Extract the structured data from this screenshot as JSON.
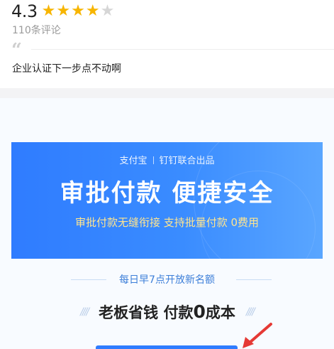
{
  "rating": {
    "score": "4.3",
    "stars_full": 4,
    "stars_total": 5,
    "review_count": "110条评论"
  },
  "review": {
    "text": "企业认证下一步点不动啊"
  },
  "banner": {
    "partner_left": "支付宝",
    "partner_right": "钉钉联合出品",
    "title": "审批付款  便捷安全",
    "subtitle": "审批付款无缝衔接  支持批量付款  0费用"
  },
  "daily": {
    "text": "每日早7点开放新名额"
  },
  "slogan": {
    "part1": "老板省钱  付款",
    "zero": "0",
    "part2": "成本"
  },
  "colors": {
    "banner_blue": "#2f7cff",
    "star_gold": "#f7b500",
    "subtitle_yellow": "#ffe58f",
    "arrow_red": "#e53935"
  }
}
